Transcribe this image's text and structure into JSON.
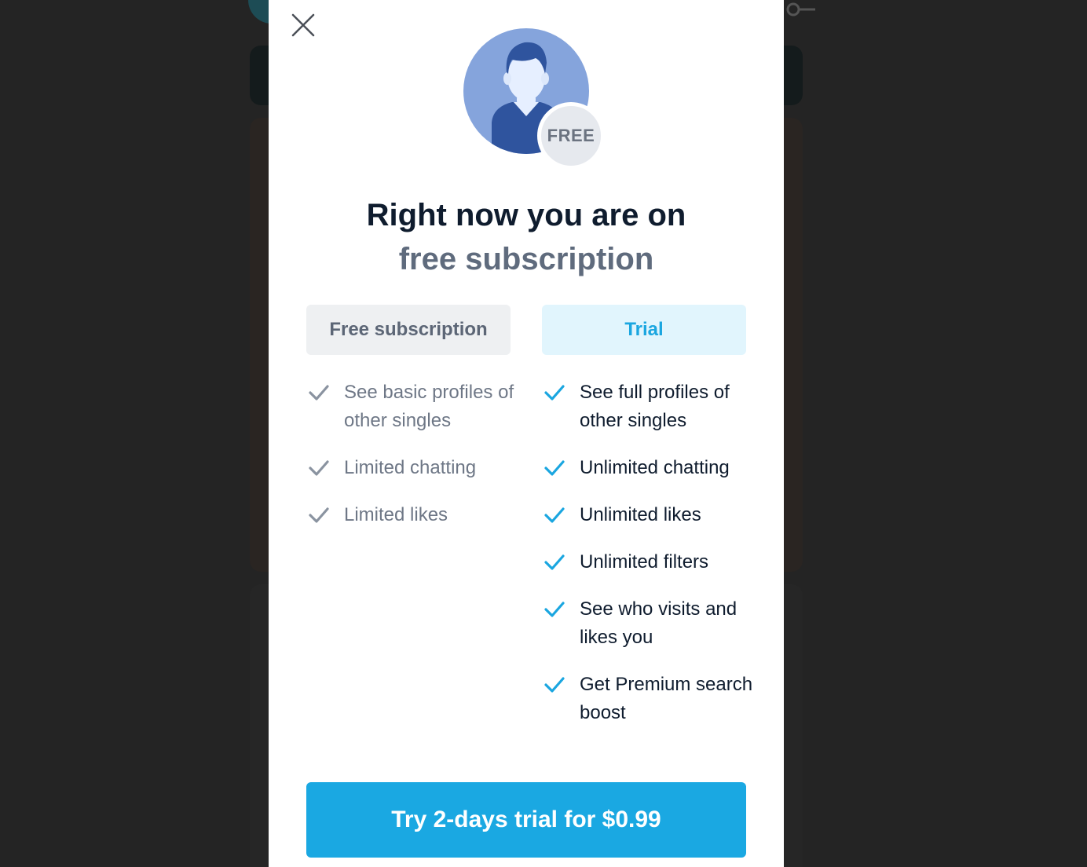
{
  "modal": {
    "badge": "FREE",
    "headline_line1": "Right now you are on",
    "headline_line2": "free subscription",
    "tabs": {
      "free": "Free subscription",
      "trial": "Trial"
    },
    "free_features": [
      "See basic profiles of other singles",
      "Limited chatting",
      "Limited likes"
    ],
    "trial_features": [
      "See full profiles of other singles",
      "Unlimited chatting",
      "Unlimited likes",
      "Unlimited filters",
      "See who visits and likes you",
      "Get Premium search boost"
    ],
    "cta_label": "Try 2-days trial for $0.99"
  },
  "colors": {
    "accent": "#1aa8e2",
    "free_check": "#8a93a0",
    "trial_check": "#1aa6e0"
  },
  "icons": {
    "close": "close-icon",
    "avatar": "user-avatar-icon",
    "check": "check-icon"
  }
}
